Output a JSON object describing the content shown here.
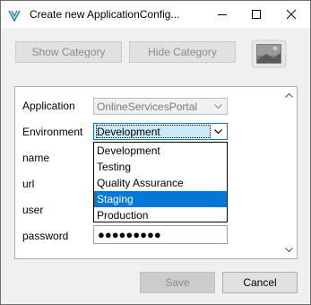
{
  "window": {
    "title": "Create new ApplicationConfig..."
  },
  "toolbar": {
    "show_category": "Show Category",
    "hide_category": "Hide Category"
  },
  "form": {
    "application": {
      "label": "Application",
      "value": "OnlineServicesPortal"
    },
    "environment": {
      "label": "Environment",
      "value": "Development",
      "options": [
        "Development",
        "Testing",
        "Quality Assurance",
        "Staging",
        "Production"
      ],
      "highlighted": "Staging"
    },
    "name": {
      "label": "name"
    },
    "url": {
      "label": "url"
    },
    "user": {
      "label": "user"
    },
    "password": {
      "label": "password",
      "value": "●●●●●●●●●"
    }
  },
  "buttons": {
    "save": "Save",
    "cancel": "Cancel"
  },
  "colors": {
    "selection": "#0078d7",
    "focus_fill": "#cce8ff",
    "logo_teal": "#2b8fa8"
  }
}
